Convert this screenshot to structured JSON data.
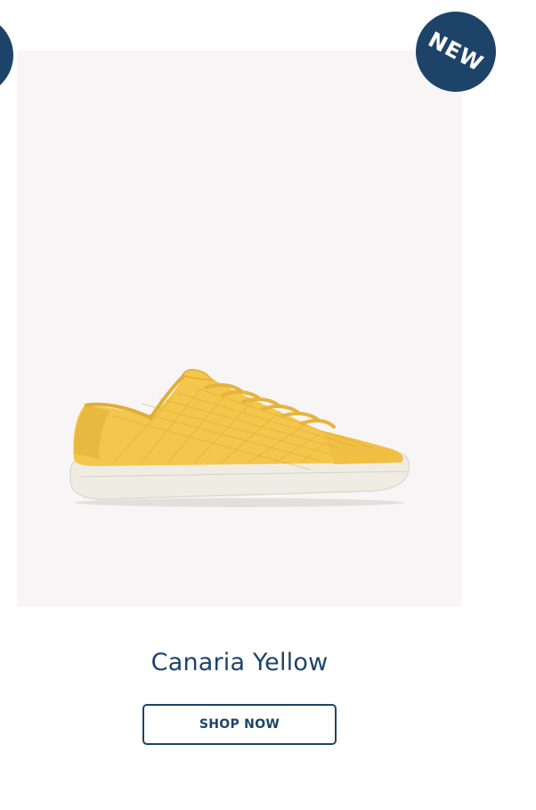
{
  "colors": {
    "brand_navy": "#1d4468",
    "image_background": "#f7f5f6",
    "shoe_yellow": "#f4c64b",
    "sole_white": "#efece3"
  },
  "carousel": {
    "badge_label": "NEW",
    "product": {
      "name": "Canaria Yellow",
      "image_alt": "Canaria Yellow mesh sneaker",
      "cta_label": "SHOP NOW"
    }
  }
}
